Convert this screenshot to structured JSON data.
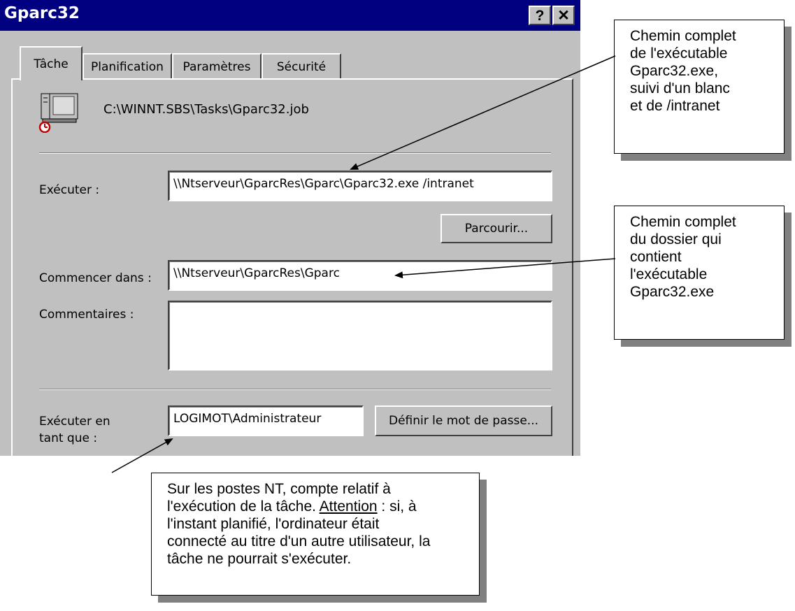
{
  "window": {
    "title": "Gparc32",
    "help_label": "?",
    "close_label": "✕"
  },
  "tabs": [
    {
      "label": "Tâche",
      "active": true
    },
    {
      "label": "Planification",
      "active": false
    },
    {
      "label": "Paramètres",
      "active": false
    },
    {
      "label": "Sécurité",
      "active": false
    }
  ],
  "task": {
    "icon": "scheduled-task-icon",
    "path": "C:\\WINNT.SBS\\Tasks\\Gparc32.job"
  },
  "form": {
    "run_label": "Exécuter :",
    "run_value": "\\\\Ntserveur\\GparcRes\\Gparc\\Gparc32.exe  /intranet",
    "browse_label": "Parcourir...",
    "start_in_label": "Commencer dans :",
    "start_in_value": "\\\\Ntserveur\\GparcRes\\Gparc",
    "comments_label": "Commentaires :",
    "comments_value": "",
    "run_as_label_line1": "Exécuter en",
    "run_as_label_line2": "tant que :",
    "run_as_value": "LOGIMOT\\Administrateur",
    "set_password_label": "Définir le mot de passe..."
  },
  "callouts": {
    "executable": {
      "lines": [
        "Chemin complet",
        "de l'exécutable",
        "Gparc32.exe,",
        "suivi d'un blanc",
        "et de /intranet"
      ]
    },
    "folder": {
      "lines": [
        "Chemin complet",
        "du dossier qui",
        "contient",
        "l'exécutable",
        "Gparc32.exe"
      ]
    },
    "account": {
      "line1": "Sur les postes NT, compte relatif à",
      "line2_pre": "l'exécution de la tâche. ",
      "line2_underlined": "Attention",
      "line2_post": " : si, à",
      "line3": "l'instant planifié, l'ordinateur était",
      "line4": "connecté au titre d'un autre utilisateur, la",
      "line5": "tâche ne pourrait s'exécuter."
    }
  }
}
